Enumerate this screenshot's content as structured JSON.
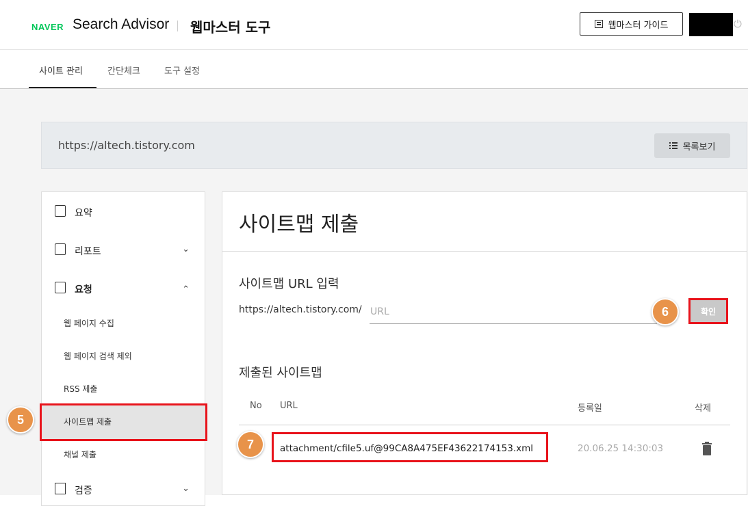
{
  "header": {
    "brand": "NAVER",
    "product": "Search Advisor",
    "tool_title": "웹마스터 도구",
    "guide_button": "웹마스터 가이드"
  },
  "tabs": [
    {
      "label": "사이트 관리",
      "active": true
    },
    {
      "label": "간단체크",
      "active": false
    },
    {
      "label": "도구 설정",
      "active": false
    }
  ],
  "site": {
    "url": "https://altech.tistory.com",
    "list_button": "목록보기"
  },
  "sidebar": {
    "items": [
      {
        "label": "요약",
        "icon": "clipboard-icon"
      },
      {
        "label": "리포트",
        "icon": "chart-icon"
      },
      {
        "label": "요청",
        "icon": "clipboard-check-icon"
      },
      {
        "label": "검증",
        "icon": "repeat-icon"
      }
    ],
    "sub_items": [
      "웹 페이지 수집",
      "웹 페이지 검색 제외",
      "RSS 제출",
      "사이트맵 제출",
      "채널 제출"
    ]
  },
  "main": {
    "title": "사이트맵 제출",
    "input_section_title": "사이트맵 URL 입력",
    "url_prefix": "https://altech.tistory.com/",
    "url_placeholder": "URL",
    "confirm_button": "확인",
    "submitted_title": "제출된 사이트맵",
    "table": {
      "headers": {
        "no": "No",
        "url": "URL",
        "date": "등록일",
        "delete": "삭제"
      },
      "rows": [
        {
          "url": "attachment/cfile5.uf@99CA8A475EF43622174153.xml",
          "date": "20.06.25 14:30:03"
        }
      ]
    }
  },
  "annotations": {
    "badge5": "5",
    "badge6": "6",
    "badge7": "7",
    "highlight_color": "#e8131b",
    "badge_color": "#e8934a"
  }
}
